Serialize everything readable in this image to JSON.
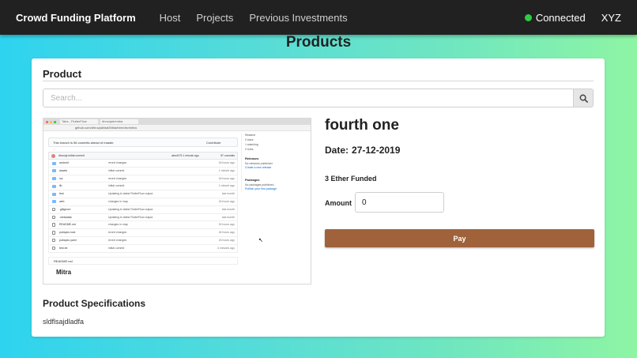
{
  "navbar": {
    "brand": "Crowd Funding Platform",
    "links": [
      "Host",
      "Projects",
      "Previous Investments"
    ],
    "status": "Connected",
    "status_color": "#2ecc40",
    "user": "XYZ"
  },
  "page": {
    "heading": "Products"
  },
  "card": {
    "title": "Product",
    "search_placeholder": "Search...",
    "search_icon": "search-icon"
  },
  "product": {
    "name": "fourth one",
    "date_label": "Date:",
    "date_value": "27-12-2019",
    "funded": "3 Ether Funded",
    "amount_label": "Amount",
    "amount_value": "0",
    "pay_label": "Pay",
    "pay_color": "#a0623b",
    "spec_title": "Product Specifications",
    "spec_text": "sldflsajdladfa"
  },
  "thumbnail": {
    "tab1": "Tabs - FlutterFlow",
    "tab2": "dhruvjain/mitra",
    "address": "github.com/dhruvjaihiral/Mitra/tree/dev/mitra",
    "ahead_text": "This branch is 56 commits ahead of master.",
    "contribute": "Contribute",
    "commit_author": "dhruvja initial commit",
    "commit_meta": "abcd175 1 minute ago",
    "commit_count": "57 commits",
    "files": [
      {
        "name": "android",
        "msg": "revert changes",
        "time": "18 hours ago",
        "dir": true
      },
      {
        "name": "assets",
        "msg": "initial commit",
        "time": "1 minute ago",
        "dir": true
      },
      {
        "name": "ios",
        "msg": "revert changes",
        "time": "18 hours ago",
        "dir": true
      },
      {
        "name": "lib",
        "msg": "initial commit",
        "time": "1 minute ago",
        "dir": true
      },
      {
        "name": "test",
        "msg": "Updating to latest FlutterFlow output.",
        "time": "last month",
        "dir": true
      },
      {
        "name": "web",
        "msg": "changes in map",
        "time": "18 hours ago",
        "dir": true
      },
      {
        "name": ".gitignore",
        "msg": "Updating to latest FlutterFlow output.",
        "time": "last month",
        "dir": false
      },
      {
        "name": ".metadata",
        "msg": "Updating to latest FlutterFlow output.",
        "time": "last month",
        "dir": false
      },
      {
        "name": "README.md",
        "msg": "changes in map",
        "time": "18 hours ago",
        "dir": false
      },
      {
        "name": "pubspec.lock",
        "msg": "revert changes",
        "time": "18 hours ago",
        "dir": false
      },
      {
        "name": "pubspec.yaml",
        "msg": "revert changes",
        "time": "18 hours ago",
        "dir": false
      },
      {
        "name": "test.txt",
        "msg": "initial commit",
        "time": "4 minutes ago",
        "dir": false
      }
    ],
    "readme_label": "README.md",
    "readme_title": "Mitra",
    "sidebar": [
      "Readme",
      "0 stars",
      "1 watching",
      "0 forks"
    ],
    "releases_head": "Releases",
    "releases_text": "No releases published",
    "releases_link": "Create a new release",
    "packages_head": "Packages",
    "packages_text": "No packages published",
    "packages_link": "Publish your first package"
  }
}
